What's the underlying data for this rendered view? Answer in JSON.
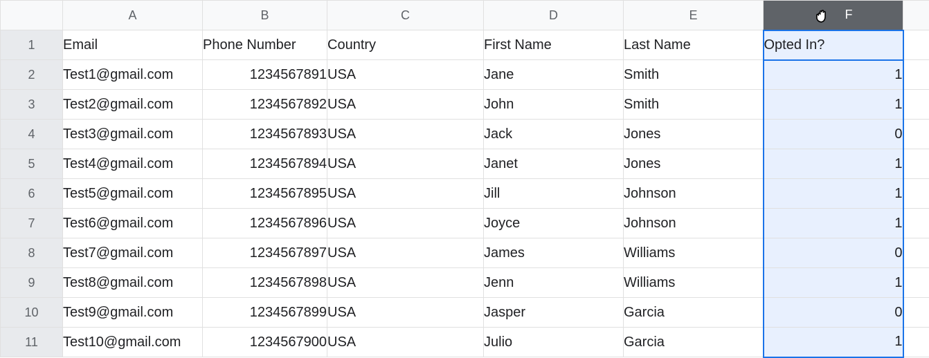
{
  "columns": [
    "A",
    "B",
    "C",
    "D",
    "E",
    "F"
  ],
  "row_headers": [
    "1",
    "2",
    "3",
    "4",
    "5",
    "6",
    "7",
    "8",
    "9",
    "10",
    "11"
  ],
  "selected_column": "F",
  "active_cell": "F1",
  "headers": {
    "A": "Email",
    "B": "Phone Number",
    "C": "Country",
    "D": "First Name",
    "E": "Last Name",
    "F": "Opted In?"
  },
  "rows": [
    {
      "email": "Test1@gmail.com",
      "phone": "1234567891",
      "country": "USA",
      "first": "Jane",
      "last": "Smith",
      "opted": "1"
    },
    {
      "email": "Test2@gmail.com",
      "phone": "1234567892",
      "country": "USA",
      "first": "John",
      "last": "Smith",
      "opted": "1"
    },
    {
      "email": "Test3@gmail.com",
      "phone": "1234567893",
      "country": "USA",
      "first": "Jack",
      "last": "Jones",
      "opted": "0"
    },
    {
      "email": "Test4@gmail.com",
      "phone": "1234567894",
      "country": "USA",
      "first": "Janet",
      "last": "Jones",
      "opted": "1"
    },
    {
      "email": "Test5@gmail.com",
      "phone": "1234567895",
      "country": "USA",
      "first": "Jill",
      "last": "Johnson",
      "opted": "1"
    },
    {
      "email": "Test6@gmail.com",
      "phone": "1234567896",
      "country": "USA",
      "first": "Joyce",
      "last": "Johnson",
      "opted": "1"
    },
    {
      "email": "Test7@gmail.com",
      "phone": "1234567897",
      "country": "USA",
      "first": "James",
      "last": "Williams",
      "opted": "0"
    },
    {
      "email": "Test8@gmail.com",
      "phone": "1234567898",
      "country": "USA",
      "first": "Jenn",
      "last": "Williams",
      "opted": "1"
    },
    {
      "email": "Test9@gmail.com",
      "phone": "1234567899",
      "country": "USA",
      "first": "Jasper",
      "last": "Garcia",
      "opted": "0"
    },
    {
      "email": "Test10@gmail.com",
      "phone": "1234567900",
      "country": "USA",
      "first": "Julio",
      "last": "Garcia",
      "opted": "1"
    }
  ],
  "cursor_icon": "grab-cursor-icon"
}
